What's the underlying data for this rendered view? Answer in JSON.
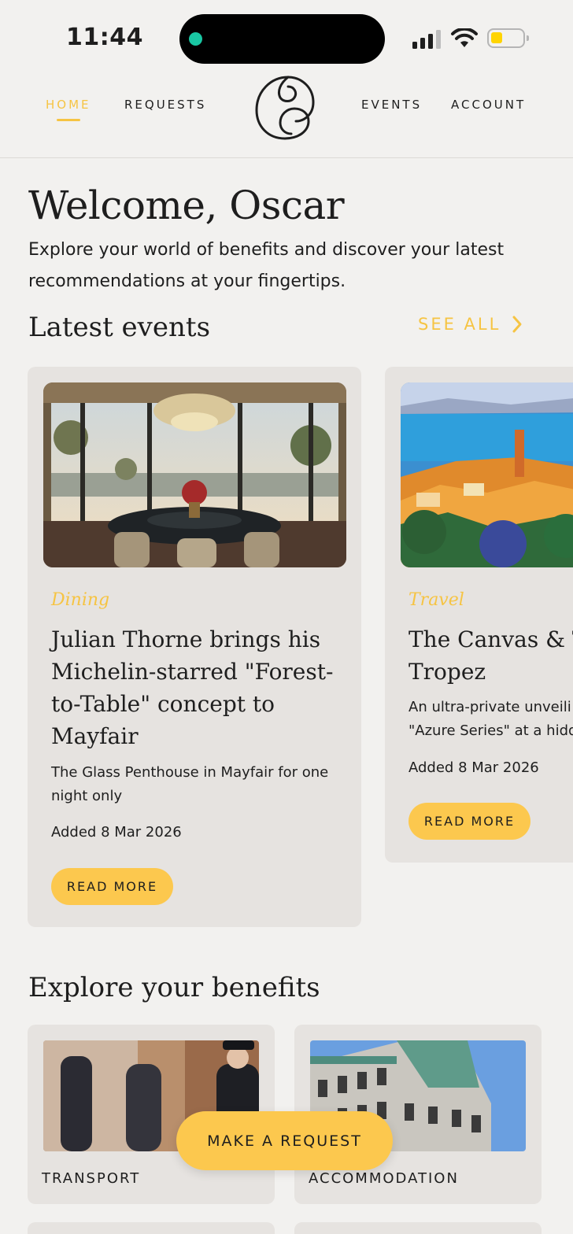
{
  "status_bar": {
    "time": "11:44"
  },
  "nav": {
    "items": [
      {
        "label": "HOME",
        "active": true
      },
      {
        "label": "REQUESTS",
        "active": false
      },
      {
        "label": "EVENTS",
        "active": false
      },
      {
        "label": "ACCOUNT",
        "active": false
      }
    ],
    "logo_icon": "spiral-logo-icon"
  },
  "welcome": {
    "title": "Welcome, Oscar",
    "intro": "Explore your world of benefits and discover your latest recommendations at your fingertips."
  },
  "events": {
    "section_title": "Latest events",
    "see_all": "SEE ALL",
    "cards": [
      {
        "category": "Dining",
        "title": "Julian Thorne brings his Michelin-starred \"Forest-to-Table\" concept to Mayfair",
        "description": "The Glass Penthouse in Mayfair for one night only",
        "date": "Added 8 Mar 2026",
        "button": "READ MORE"
      },
      {
        "category": "Travel",
        "title": "The Canvas & T Tropez",
        "description": "An ultra-private unveili \"Azure Series\" at a hidde",
        "date": "Added 8 Mar 2026",
        "button": "READ MORE"
      }
    ]
  },
  "benefits": {
    "section_title": "Explore your benefits",
    "cards": [
      {
        "label": "TRANSPORT"
      },
      {
        "label": "ACCOMMODATION"
      }
    ]
  },
  "fab": {
    "label": "MAKE A REQUEST"
  },
  "colors": {
    "accent": "#f6c443",
    "button": "#fcc84e",
    "card": "#e6e3e0",
    "background": "#f2f1ef"
  }
}
